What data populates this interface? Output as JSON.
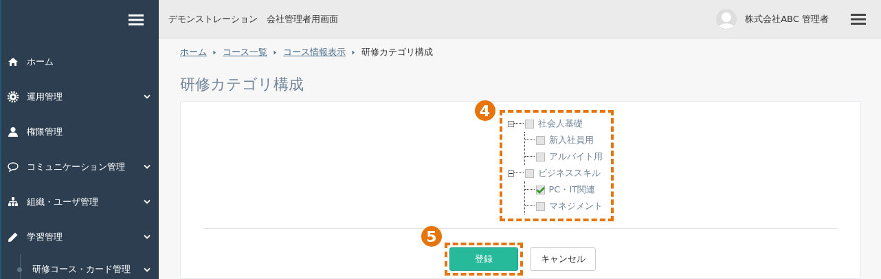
{
  "sidebar": {
    "items": [
      {
        "label": "ホーム",
        "expandable": false
      },
      {
        "label": "運用管理",
        "expandable": true
      },
      {
        "label": "権限管理",
        "expandable": false
      },
      {
        "label": "コミュニケーション管理",
        "expandable": true
      },
      {
        "label": "組織・ユーザ管理",
        "expandable": true
      },
      {
        "label": "学習管理",
        "expandable": true,
        "children": [
          {
            "label": "研修コース・カード管理",
            "expandable": true
          }
        ]
      }
    ]
  },
  "header": {
    "title": "デモンストレーション　会社管理者用画面",
    "user": "株式会社ABC 管理者"
  },
  "breadcrumb": [
    {
      "label": "ホーム",
      "link": true
    },
    {
      "label": "コース一覧",
      "link": true
    },
    {
      "label": "コース情報表示",
      "link": true
    },
    {
      "label": "研修カテゴリ構成",
      "link": false
    }
  ],
  "page_title": "研修カテゴリ構成",
  "tree": {
    "badge": "4",
    "nodes": [
      {
        "label": "社会人基礎",
        "checked": false,
        "expanded": true,
        "children": [
          {
            "label": "新入社員用",
            "checked": false
          },
          {
            "label": "アルバイト用",
            "checked": false
          }
        ]
      },
      {
        "label": "ビジネススキル",
        "checked": false,
        "expanded": true,
        "children": [
          {
            "label": "PC・IT関連",
            "checked": true
          },
          {
            "label": "マネジメント",
            "checked": false
          }
        ]
      }
    ]
  },
  "actions": {
    "badge": "5",
    "buttons": [
      {
        "label": "登録",
        "kind": "primary"
      },
      {
        "label": "キャンセル",
        "kind": "default"
      }
    ]
  }
}
